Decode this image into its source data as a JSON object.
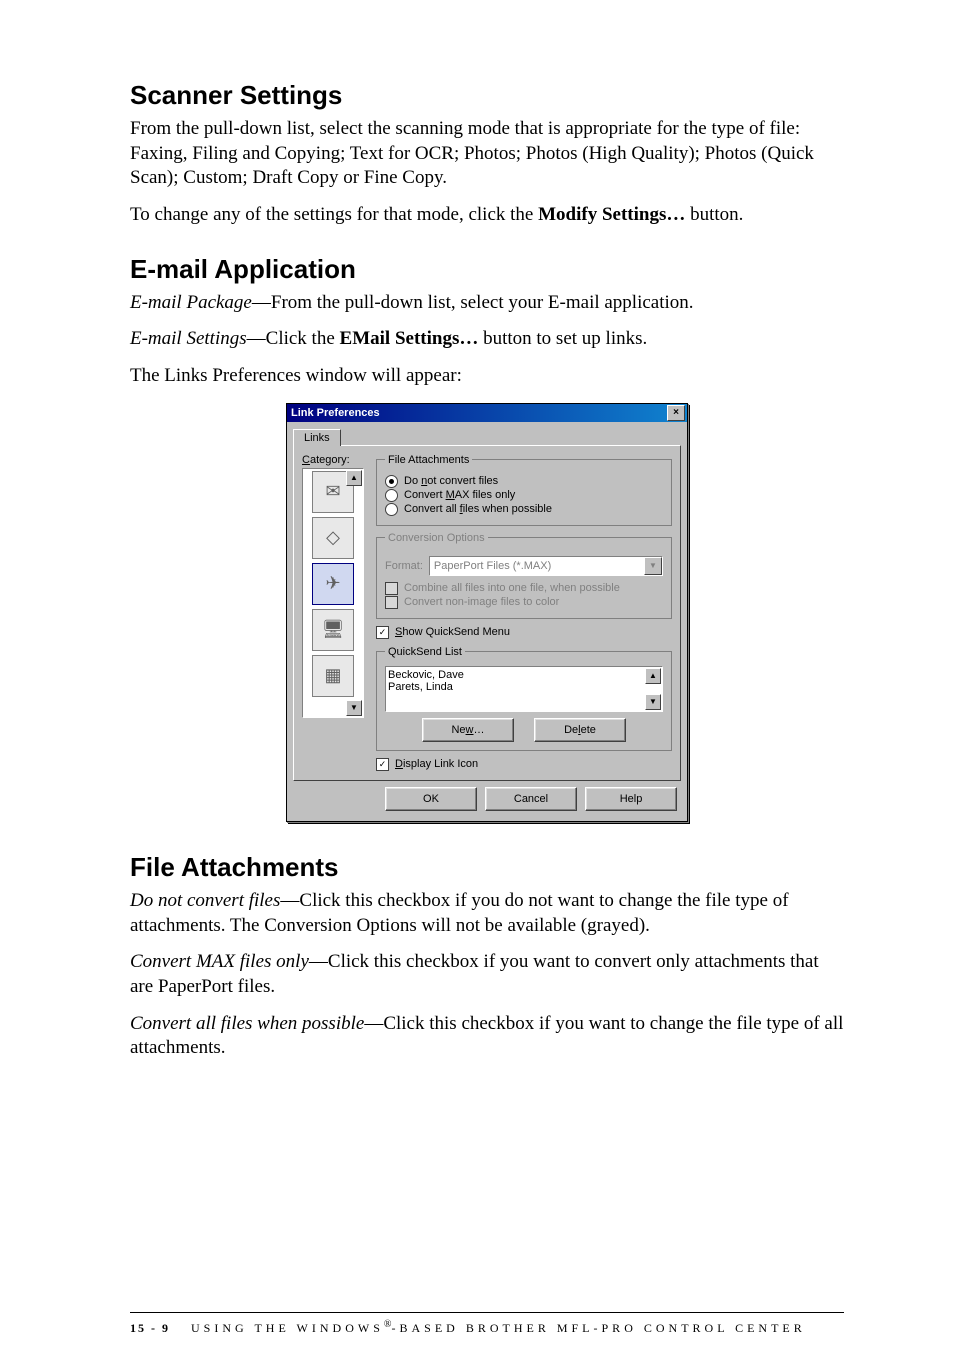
{
  "sections": {
    "scanner": {
      "heading": "Scanner Settings",
      "p1": "From the pull-down list, select the scanning mode that is appropriate for the type of file: Faxing, Filing and Copying; Text for OCR; Photos; Photos (High Quality); Photos (Quick Scan); Custom; Draft Copy or Fine Copy.",
      "p2_before": "To change any of the settings for that mode, click the ",
      "p2_bold": "Modify Settings…",
      "p2_after": " button."
    },
    "email": {
      "heading": "E-mail Application",
      "p1_italic": "E-mail Package",
      "p1_rest": "—From the pull-down list, select your E-mail application.",
      "p2_italic": "E-mail Settings",
      "p2_mid": "—Click the ",
      "p2_bold": "EMail Settings…",
      "p2_after": " button to set up links.",
      "p3": "The Links Preferences window will appear:"
    },
    "attachments": {
      "heading": "File Attachments",
      "p1_italic": "Do not convert files",
      "p1_rest": "—Click this checkbox if you do not want to change the file type of attachments. The Conversion Options will not be available (grayed).",
      "p2_italic": "Convert MAX files only",
      "p2_rest": "—Click this checkbox if you want to convert only attachments that are PaperPort files.",
      "p3_italic": "Convert all files when possible",
      "p3_rest": "—Click this checkbox if you want to change the file type of all attachments."
    }
  },
  "dialog": {
    "title": "Link Preferences",
    "tab": "Links",
    "category_label": "Category:",
    "fileattach": {
      "legend": "File Attachments",
      "r1": "Do not convert files",
      "r2": "Convert MAX files only",
      "r3": "Convert all files when possible"
    },
    "convopts": {
      "legend": "Conversion Options",
      "format_label": "Format:",
      "format_value": "PaperPort Files (*.MAX)",
      "c1": "Combine all files into one file, when possible",
      "c2": "Convert non-image files to color"
    },
    "show_quicksend": "Show QuickSend Menu",
    "quicksend": {
      "legend": "QuickSend List",
      "items": [
        "Beckovic, Dave",
        "Parets, Linda"
      ],
      "btn_new": "New…",
      "btn_delete": "Delete"
    },
    "display_link_icon": "Display Link Icon",
    "btns": {
      "ok": "OK",
      "cancel": "Cancel",
      "help": "Help"
    }
  },
  "footer": {
    "page": "15 - 9",
    "prefix": "USING THE WINDOWS",
    "suffix": "-BASED BROTHER MFL-PRO CONTROL CENTER"
  }
}
